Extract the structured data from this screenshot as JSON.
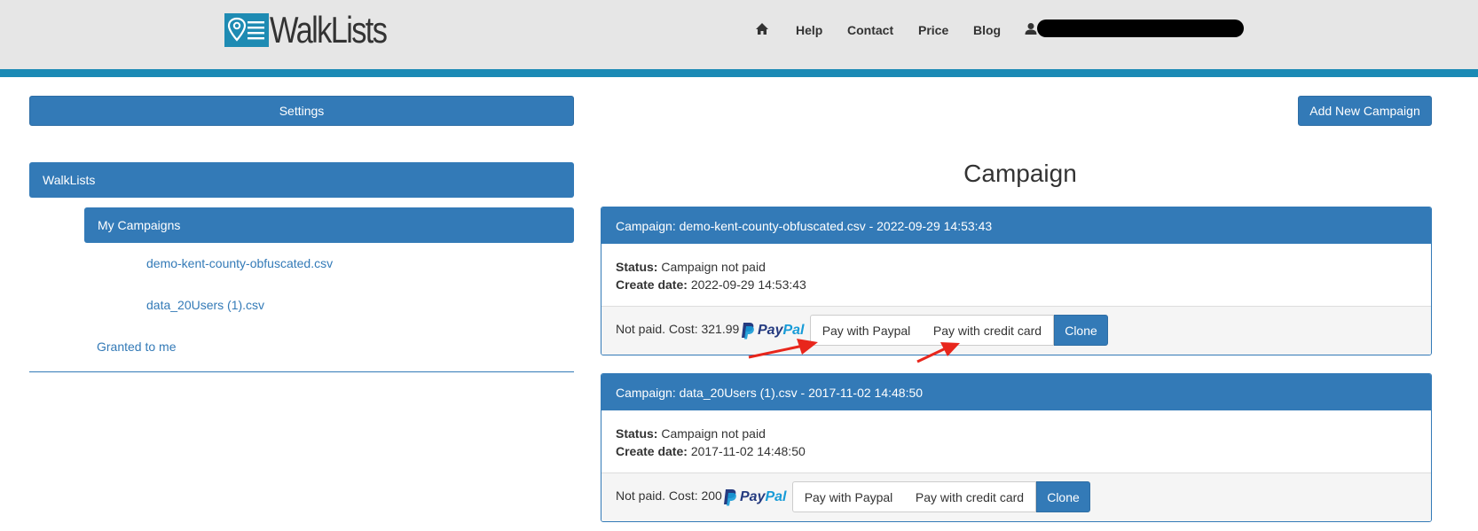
{
  "header": {
    "logo_text": "WalkLists",
    "nav": {
      "home_icon": "home-icon",
      "help": "Help",
      "contact": "Contact",
      "price": "Price",
      "blog": "Blog",
      "user_icon": "user-icon"
    },
    "colors": {
      "background": "#e6e6e6",
      "accent_bar": "#1b8ab5"
    }
  },
  "toolbar": {
    "settings_label": "Settings",
    "add_campaign_label": "Add New Campaign"
  },
  "sidebar": {
    "root_label": "WalkLists",
    "my_campaigns_label": "My Campaigns",
    "campaign_links": [
      "demo-kent-county-obfuscated.csv",
      "data_20Users (1).csv"
    ],
    "granted_label": "Granted to me"
  },
  "main": {
    "title": "Campaign",
    "campaigns": [
      {
        "heading": "Campaign: demo-kent-county-obfuscated.csv - 2022-09-29 14:53:43",
        "status_label": "Status:",
        "status_value": "Campaign not paid",
        "create_label": "Create date:",
        "create_value": "2022-09-29 14:53:43",
        "footer_text": "Not paid. Cost: 321.99",
        "pay_paypal_label": "Pay with Paypal",
        "pay_card_label": "Pay with credit card",
        "clone_label": "Clone"
      },
      {
        "heading": "Campaign: data_20Users (1).csv - 2017-11-02 14:48:50",
        "status_label": "Status:",
        "status_value": "Campaign not paid",
        "create_label": "Create date:",
        "create_value": "2017-11-02 14:48:50",
        "footer_text": "Not paid. Cost: 200",
        "pay_paypal_label": "Pay with Paypal",
        "pay_card_label": "Pay with credit card",
        "clone_label": "Clone"
      }
    ],
    "paypal_brand": {
      "pay": "Pay",
      "pal": "Pal"
    }
  },
  "colors": {
    "primary": "#337ab7",
    "annotation_arrow": "#e8261c"
  }
}
